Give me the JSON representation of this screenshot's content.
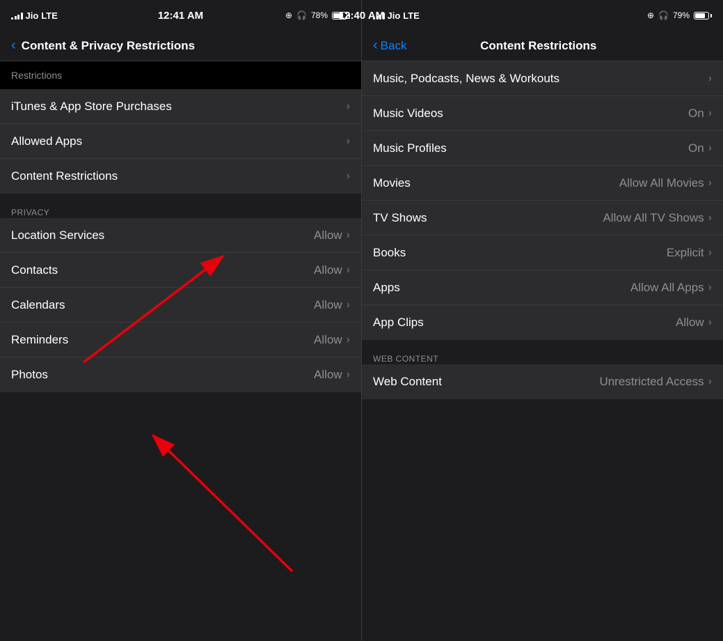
{
  "left": {
    "statusBar": {
      "carrier": "Jio",
      "network": "LTE",
      "time": "12:41 AM",
      "battery": "78%"
    },
    "navBar": {
      "backLabel": "",
      "title": "Content & Privacy Restrictions"
    },
    "topSection": {
      "label": "Restrictions"
    },
    "mainItems": [
      {
        "label": "iTunes & App Store Purchases",
        "value": ""
      },
      {
        "label": "Allowed Apps",
        "value": ""
      },
      {
        "label": "Content Restrictions",
        "value": ""
      }
    ],
    "privacyHeader": "PRIVACY",
    "privacyItems": [
      {
        "label": "Location Services",
        "value": "Allow"
      },
      {
        "label": "Contacts",
        "value": "Allow"
      },
      {
        "label": "Calendars",
        "value": "Allow"
      },
      {
        "label": "Reminders",
        "value": "Allow"
      },
      {
        "label": "Photos",
        "value": "Allow"
      }
    ]
  },
  "right": {
    "statusBar": {
      "carrier": "Jio",
      "network": "LTE",
      "time": "12:40 AM",
      "battery": "79%"
    },
    "navBar": {
      "backLabel": "Back",
      "title": "Content Restrictions"
    },
    "items": [
      {
        "label": "Music, Podcasts, News & Workouts",
        "value": ""
      },
      {
        "label": "Music Videos",
        "value": "On"
      },
      {
        "label": "Music Profiles",
        "value": "On"
      },
      {
        "label": "Movies",
        "value": "Allow All Movies"
      },
      {
        "label": "TV Shows",
        "value": "Allow All TV Shows"
      },
      {
        "label": "Books",
        "value": "Explicit"
      },
      {
        "label": "Apps",
        "value": "Allow All Apps"
      },
      {
        "label": "App Clips",
        "value": "Allow"
      }
    ],
    "webContentHeader": "WEB CONTENT",
    "webItems": [
      {
        "label": "Web Content",
        "value": "Unrestricted Access"
      }
    ]
  }
}
